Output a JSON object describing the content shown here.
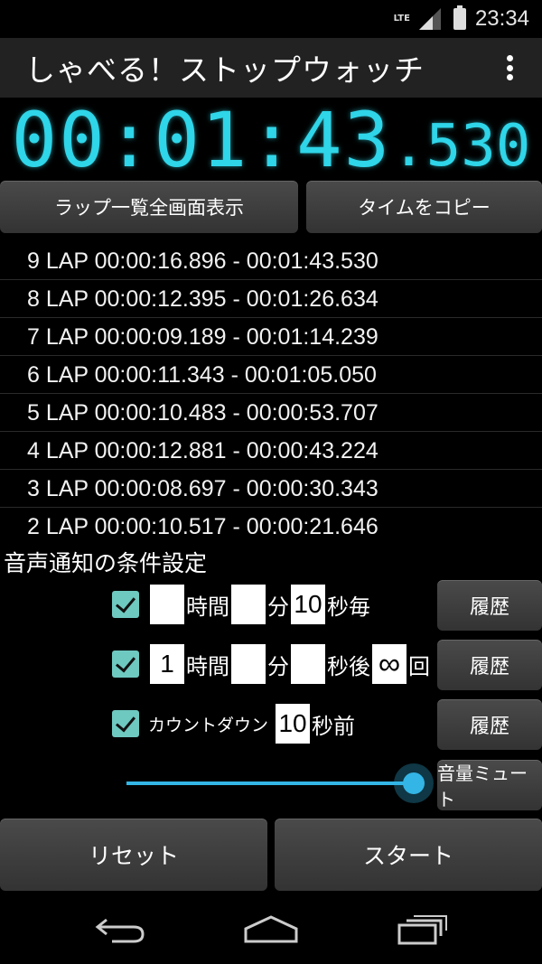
{
  "status": {
    "network": "LTE",
    "time": "23:34"
  },
  "app": {
    "title": "しゃべる！ストップウォッチ"
  },
  "timer": {
    "main": "00:01:43",
    "ms": ".530"
  },
  "buttons": {
    "lap_list": "ラップ一覧全画面表示",
    "copy_time": "タイムをコピー",
    "reset": "リセット",
    "start": "スタート"
  },
  "laps": [
    "9 LAP 00:00:16.896 - 00:01:43.530",
    "8 LAP 00:00:12.395 - 00:01:26.634",
    "7 LAP 00:00:09.189 - 00:01:14.239",
    "6 LAP 00:00:11.343 - 00:01:05.050",
    "5 LAP 00:00:10.483 - 00:00:53.707",
    "4 LAP 00:00:12.881 - 00:00:43.224",
    "3 LAP 00:00:08.697 - 00:00:30.343",
    "2 LAP 00:00:10.517 - 00:00:21.646"
  ],
  "settings": {
    "title": "音声通知の条件設定",
    "row1": {
      "hours": "",
      "hours_label": "時間",
      "minutes": "",
      "minutes_label": "分",
      "seconds": "10",
      "seconds_label": "秒毎",
      "history": "履歴"
    },
    "row2": {
      "hours": "1",
      "hours_label": "時間",
      "minutes": "",
      "minutes_label": "分",
      "seconds": "",
      "seconds_label": "秒後",
      "count": "∞",
      "count_label": "回",
      "history": "履歴"
    },
    "row3": {
      "label": "カウントダウン",
      "seconds": "10",
      "seconds_label": "秒前",
      "history": "履歴"
    },
    "volume": {
      "mute_label": "音量ミュート",
      "level": 1.0
    }
  },
  "colors": {
    "timer": "#2fd5e8",
    "accent": "#33b5e5",
    "checkbox": "#6ec9c0"
  }
}
